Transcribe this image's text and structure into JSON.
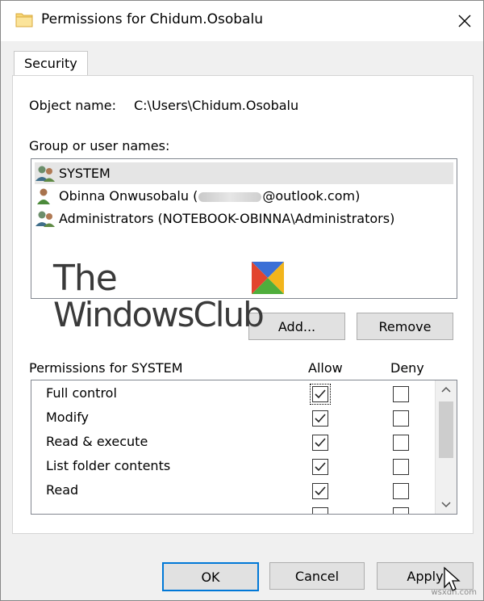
{
  "window": {
    "title": "Permissions for Chidum.Osobalu",
    "folder_icon": "folder-icon",
    "close_icon": "close-icon"
  },
  "tabs": [
    {
      "label": "Security",
      "active": true
    }
  ],
  "object": {
    "label": "Object name:",
    "value": "C:\\Users\\Chidum.Osobalu"
  },
  "groups": {
    "label": "Group or user names:",
    "items": [
      {
        "name": "SYSTEM",
        "icon": "users-group-icon",
        "selected": true
      },
      {
        "name_prefix": "Obinna Onwusobalu (",
        "name_suffix": "@outlook.com)",
        "icon": "user-icon",
        "selected": false
      },
      {
        "name": "Administrators (NOTEBOOK-OBINNA\\Administrators)",
        "icon": "users-group-icon",
        "selected": false
      }
    ],
    "add_label": "Add...",
    "remove_label": "Remove"
  },
  "watermark": {
    "line1": "The",
    "line2": "WindowsClub"
  },
  "permissions": {
    "header": "Permissions for SYSTEM",
    "allow_label": "Allow",
    "deny_label": "Deny",
    "rows": [
      {
        "name": "Full control",
        "allow": true,
        "deny": false
      },
      {
        "name": "Modify",
        "allow": true,
        "deny": false
      },
      {
        "name": "Read & execute",
        "allow": true,
        "deny": false
      },
      {
        "name": "List folder contents",
        "allow": true,
        "deny": false
      },
      {
        "name": "Read",
        "allow": true,
        "deny": false
      }
    ]
  },
  "buttons": {
    "ok": "OK",
    "cancel": "Cancel",
    "apply": "Apply"
  },
  "site_mark": "wsxdn.com",
  "colors": {
    "accent": "#0078d7",
    "selected_row": "#e5e5e5"
  }
}
